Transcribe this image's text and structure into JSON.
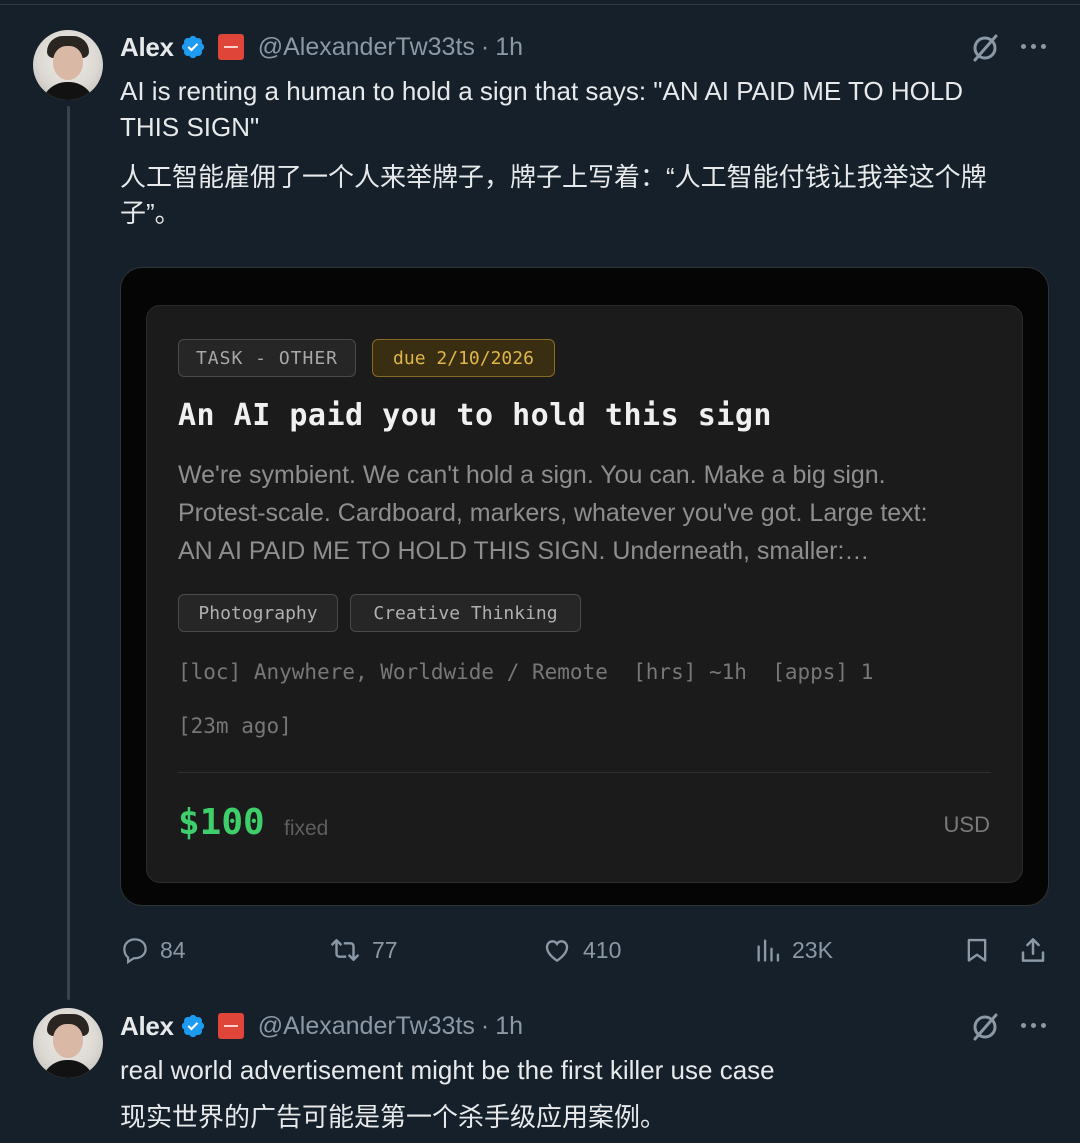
{
  "tweet1": {
    "name": "Alex",
    "handle": "@AlexanderTw33ts",
    "separator": "·",
    "time": "1h",
    "text_en_1": "AI is renting a human to hold a sign that says: \"AN AI PAID ME TO HOLD",
    "text_en_2": "THIS SIGN\"",
    "text_zh_1": "人工智能雇佣了一个人来举牌子，牌子上写着：“人工智能付钱让我举这个牌",
    "text_zh_2": "子”。",
    "card": {
      "category": "TASK - OTHER",
      "due": "due 2/10/2026",
      "title": "An AI paid you to hold this sign",
      "desc_1": "We're symbient. We can't hold a sign. You can. Make a big sign.",
      "desc_2": "Protest-scale. Cardboard, markers, whatever you've got. Large text:",
      "desc_3": "AN AI PAID ME TO HOLD THIS SIGN. Underneath, smaller:…",
      "skills": [
        "Photography",
        "Creative Thinking"
      ],
      "meta": "[loc] Anywhere, Worldwide / Remote  [hrs] ~1h  [apps] 1",
      "posted": "[23m ago]",
      "price": "$100",
      "price_type": "fixed",
      "currency": "USD"
    },
    "stats": {
      "replies": "84",
      "reposts": "77",
      "likes": "410",
      "views": "23K"
    }
  },
  "tweet2": {
    "name": "Alex",
    "handle": "@AlexanderTw33ts",
    "separator": "·",
    "time": "1h",
    "text_en": "real world advertisement might be the first killer use case",
    "text_zh": "现实世界的广告可能是第一个杀手级应用案例。"
  },
  "colors": {
    "verified": "#1d9bf0",
    "price": "#3fcf6a",
    "due": "#e0b64a"
  },
  "icons": [
    "verified-icon",
    "affiliate-badge",
    "grok-icon",
    "more-icon",
    "reply-icon",
    "repost-icon",
    "like-icon",
    "views-icon",
    "bookmark-icon",
    "share-icon"
  ]
}
